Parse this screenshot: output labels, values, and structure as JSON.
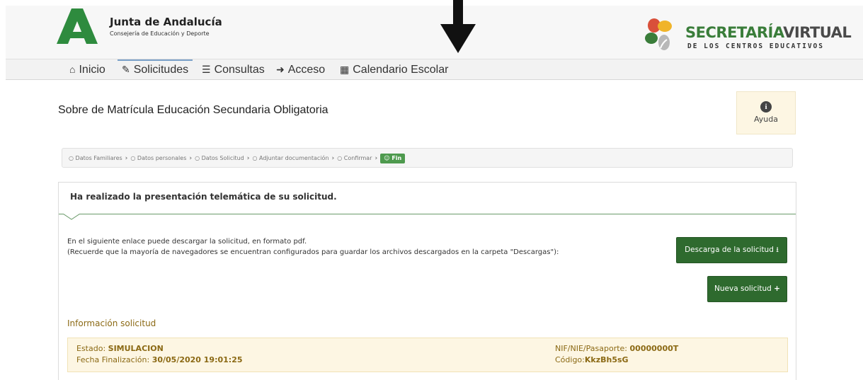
{
  "header": {
    "org_name": "Junta de Andalucía",
    "org_sub": "Consejería de Educación y Deporte",
    "brand_title_green": "SECRETARÍA",
    "brand_title_dark": "VIRTUAL",
    "brand_sub": "DE LOS CENTROS EDUCATIVOS",
    "colors": {
      "brand_green": "#3a7d3a",
      "logo_green": "#2e8b3e"
    }
  },
  "nav": {
    "items": [
      {
        "label": "Inicio",
        "icon": "home-icon"
      },
      {
        "label": "Solicitudes",
        "icon": "pencil-icon"
      },
      {
        "label": "Consultas",
        "icon": "list-icon"
      },
      {
        "label": "Acceso",
        "icon": "sign-in-icon"
      },
      {
        "label": "Calendario Escolar",
        "icon": "calendar-icon"
      }
    ],
    "active": "Solicitudes"
  },
  "page": {
    "title": "Sobre de Matrícula Educación Secundaria Obligatoria",
    "help_label": "Ayuda"
  },
  "breadcrumb": {
    "steps": [
      "Datos Familiares",
      "Datos personales",
      "Datos Solicitud",
      "Adjuntar documentación",
      "Confirmar"
    ],
    "final": "Fin"
  },
  "panel": {
    "heading": "Ha realizado la presentación telemática de su solicitud.",
    "line1": "En el siguiente enlace puede descargar la solicitud, en formato pdf.",
    "line2": "(Recuerde que la mayoría de navegadores se encuentran configurados para guardar los archivos descargados en la carpeta \"Descargas\"):",
    "download_button": "Descarga de la solicitud",
    "new_button": "Nueva solicitud",
    "info_title": "Información solicitud",
    "estado_label": "Estado: ",
    "estado_value": "SIMULACION",
    "fecha_label": "Fecha Finalización: ",
    "fecha_value": "30/05/2020 19:01:25",
    "nif_label": "NIF/NIE/Pasaporte: ",
    "nif_value": "00000000T",
    "codigo_label": "Código:",
    "codigo_value": "KkzBh5sG"
  }
}
